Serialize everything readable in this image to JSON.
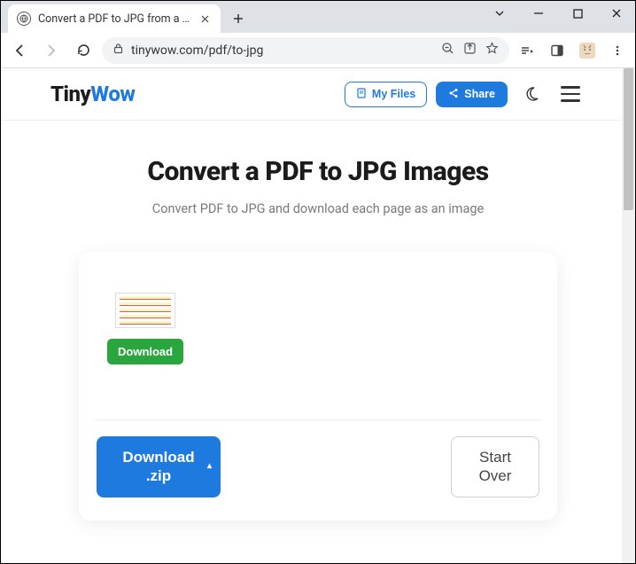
{
  "browser": {
    "tab_title": "Convert a PDF to JPG from a Sma",
    "url": "tinywow.com/pdf/to-jpg"
  },
  "header": {
    "logo_tiny": "Tiny",
    "logo_wow": "Wow",
    "myfiles_label": "My Files",
    "share_label": "Share"
  },
  "main": {
    "title": "Convert a PDF to JPG Images",
    "subtitle": "Convert PDF to JPG and download each page as an image"
  },
  "card": {
    "thumbs": [
      {
        "download_label": "Download"
      }
    ],
    "downloadzip_line1": "Download",
    "downloadzip_line2": ".zip",
    "startover_line1": "Start",
    "startover_line2": "Over"
  }
}
